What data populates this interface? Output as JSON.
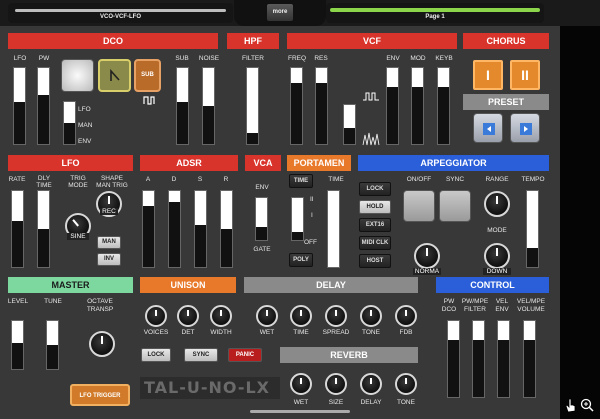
{
  "topbar": {
    "preset_name": "VCO-VCF-LFO",
    "more_label": "more",
    "page_label": "Page 1"
  },
  "dco": {
    "title": "DCO",
    "lfo": "LFO",
    "pw": "PW",
    "sub": "SUB",
    "noise": "NOISE",
    "mod_sources": [
      "LFO",
      "MAN",
      "ENV"
    ],
    "sub_button": "SUB",
    "values": {
      "lfo": 0.55,
      "pw": 0.65,
      "pwsrc": 0.5,
      "sub": 0.55,
      "noise": 0.5
    }
  },
  "hpf": {
    "title": "HPF",
    "filter": "FILTER",
    "value": 0.15
  },
  "vcf": {
    "title": "VCF",
    "freq": "FREQ",
    "res": "RES",
    "env": "ENV",
    "mod": "MOD",
    "keyb": "KEYB",
    "values": {
      "freq": 0.8,
      "res": 0.8,
      "lfo": 0.4,
      "env": 0.75,
      "mod": 0.75,
      "keyb": 0.75
    }
  },
  "chorus": {
    "title": "CHORUS",
    "btn1": "I",
    "btn2": "II",
    "preset_title": "PRESET"
  },
  "lfo": {
    "title": "LFO",
    "rate": "RATE",
    "delay": "DLY\nTIME",
    "trig_mode": "TRIG\nMODE",
    "shape": "SHAPE\nMAN TRIG",
    "rec": "REC",
    "sine": "SINE",
    "man": "MAN",
    "inv": "INV",
    "values": {
      "rate": 0.6,
      "delay": 0.5
    }
  },
  "adsr": {
    "title": "ADSR",
    "a": "A",
    "d": "D",
    "s": "S",
    "r": "R",
    "values": {
      "a": 0.8,
      "d": 0.85,
      "s": 0.55,
      "r": 0.5
    }
  },
  "vca": {
    "title": "VCA",
    "env": "ENV",
    "gate": "GATE",
    "value": 0.3
  },
  "portamento": {
    "title": "PORTAMEN",
    "time_btn": "TIME",
    "time": "TIME",
    "marks": [
      "II",
      "I",
      "OFF"
    ],
    "poly": "POLY",
    "value": 0.2
  },
  "arpeggiator": {
    "title": "ARPEGGIATOR",
    "lock": "LOCK",
    "hold": "HOLD",
    "ext16": "EXT16",
    "midi_clk": "MIDI CLK",
    "host": "HOST",
    "onoff": "ON/OFF",
    "sync": "SYNC",
    "range": "RANGE",
    "tempo": "TEMPO",
    "mode": "MODE",
    "norma": "NORMA",
    "down": "DOWN",
    "tempo_value": 0.25
  },
  "master": {
    "title": "MASTER",
    "level": "LEVEL",
    "tune": "TUNE",
    "octave": "OCTAVE\nTRANSP",
    "values": {
      "level": 0.55,
      "tune": 0.5
    },
    "lfo_trigger": "LFO TRIGGER"
  },
  "unison": {
    "title": "UNISON",
    "voices": "VOICES",
    "det": "DET",
    "width": "WIDTH",
    "lock": "LOCK",
    "sync": "SYNC",
    "panic": "PANIC"
  },
  "delay": {
    "title": "DELAY",
    "wet": "WET",
    "time": "TIME",
    "spread": "SPREAD",
    "tone": "TONE",
    "fdb": "FDB"
  },
  "reverb": {
    "title": "REVERB",
    "wet": "WET",
    "size": "SIZE",
    "delay": "DELAY",
    "tone": "TONE"
  },
  "control": {
    "title": "CONTROL",
    "pw_dco": "PW\nDCO",
    "pw_filter": "PW/MPE\nFILTER",
    "vel_env": "VEL\nENV",
    "vel_volume": "VEL/MPE\nVOLUME",
    "values": {
      "a": 0.75,
      "b": 0.75,
      "c": 0.75,
      "d": 0.75
    }
  },
  "logo": "TAL-U-NO-LX",
  "colors": {
    "red": "#d9342b",
    "orange": "#e8782a",
    "blue": "#2b5fd9",
    "green": "#7dd8a0",
    "lcd_green": "#8bd64a"
  }
}
